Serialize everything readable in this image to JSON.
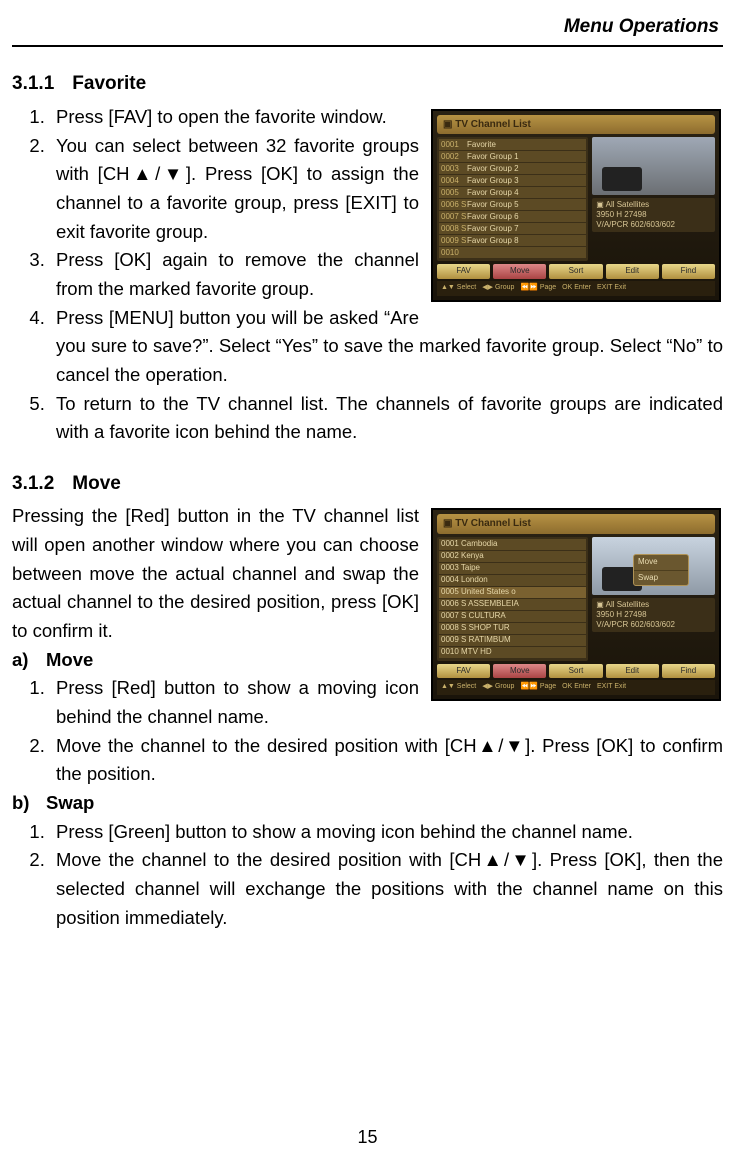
{
  "header": {
    "section_title": "Menu Operations"
  },
  "h311": {
    "num": "3.1.1",
    "title": "Favorite"
  },
  "fav_list": [
    "Press [FAV] to open the favorite window.",
    "You can select between 32 favorite groups with [CH▲/▼]. Press [OK] to assign the channel to a favorite group, press [EXIT] to exit favorite group.",
    "Press [OK] again to remove the channel from the marked favorite group.",
    "Press [MENU] button you will be asked “Are you sure to save?”. Select “Yes” to save the marked favorite group. Select “No” to cancel the operation.",
    "To return to the TV channel list. The channels of favorite groups are indicated with a favorite icon behind the name."
  ],
  "h312": {
    "num": "3.1.2",
    "title": "Move"
  },
  "move_intro": "Pressing the [Red] button in the TV channel list will open another window where you can choose between move the actual channel and swap the actual channel to the desired position, press [OK] to confirm it.",
  "suba": {
    "label": "a)",
    "title": "Move"
  },
  "move_a": [
    "Press [Red] button to show a moving icon behind the channel name.",
    "Move the channel to the desired position with [CH▲/▼]. Press [OK] to confirm the position."
  ],
  "subb": {
    "label": "b)",
    "title": "Swap"
  },
  "move_b": [
    "Press [Green] button to show a moving icon behind the channel name.",
    "Move the channel to the desired position with [CH▲/▼]. Press [OK], then the selected channel will exchange the positions with the channel name on this position immediately."
  ],
  "page_number": "15",
  "fig1": {
    "title": "TV Channel List",
    "rows": [
      "0001",
      "0002",
      "0003",
      "0004",
      "0005",
      "0006 S",
      "0007 S",
      "0008 S",
      "0009 S",
      "0010"
    ],
    "favgroups": [
      "Favorite",
      "Favor Group 1",
      "Favor Group 2",
      "Favor Group 3",
      "Favor Group 4",
      "Favor Group 5",
      "Favor Group 6",
      "Favor Group 7",
      "Favor Group 8"
    ],
    "side1": "All Satellites",
    "side2": "3950 H 27498",
    "side3": "V/A/PCR 602/603/602",
    "buttons": {
      "fav": "FAV",
      "move": "Move",
      "sort": "Sort",
      "edit": "Edit",
      "find": "Find"
    },
    "hints": [
      "▲▼ Select",
      "◀▶ Group",
      "⏪⏩ Page",
      "OK Enter",
      "EXIT Exit"
    ]
  },
  "fig2": {
    "title": "TV Channel List",
    "rows": [
      "0001  Cambodia",
      "0002  Kenya",
      "0003  Taipe",
      "0004  London",
      "0005  United States o",
      "0006 S ASSEMBLEIA",
      "0007 S CULTURA",
      "0008 S SHOP TUR",
      "0009 S RATIMBUM",
      "0010  MTV HD"
    ],
    "popup": [
      "Move",
      "Swap"
    ],
    "side1": "All Satellites",
    "side2": "3950 H 27498",
    "side3": "V/A/PCR 602/603/602",
    "buttons": {
      "fav": "FAV",
      "move": "Move",
      "sort": "Sort",
      "edit": "Edit",
      "find": "Find"
    },
    "hints": [
      "▲▼ Select",
      "◀▶ Group",
      "⏪⏩ Page",
      "OK Enter",
      "EXIT Exit"
    ]
  }
}
